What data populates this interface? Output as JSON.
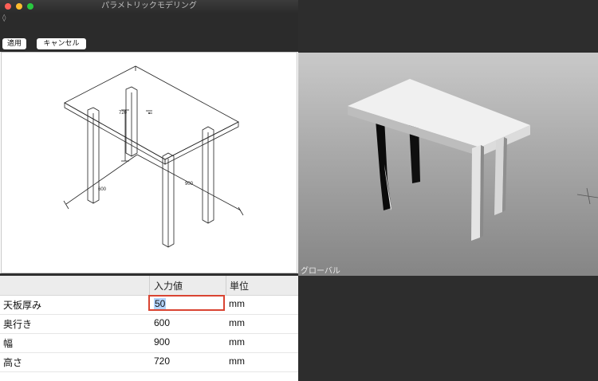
{
  "window": {
    "title": "パラメトリックモデリング",
    "pin_glyph": "◊",
    "traffic_lights": [
      "#ff5f57",
      "#febc2e",
      "#28c840"
    ]
  },
  "toolbar": {
    "apply_label": "適用",
    "cancel_label": "キャンセル"
  },
  "drawing": {
    "dim_height": "720",
    "dim_depth": "600",
    "dim_width": "900"
  },
  "table": {
    "headers": [
      "",
      "入力値",
      "単位"
    ],
    "rows": [
      {
        "name": "天板厚み",
        "value": "50",
        "unit": "mm"
      },
      {
        "name": "奥行き",
        "value": "600",
        "unit": "mm"
      },
      {
        "name": "幅",
        "value": "900",
        "unit": "mm"
      },
      {
        "name": "高さ",
        "value": "720",
        "unit": "mm"
      }
    ]
  },
  "viewport": {
    "label": "グローバル"
  },
  "colors": {
    "highlight_border": "#d94432",
    "selection": "#b3d4fd"
  }
}
